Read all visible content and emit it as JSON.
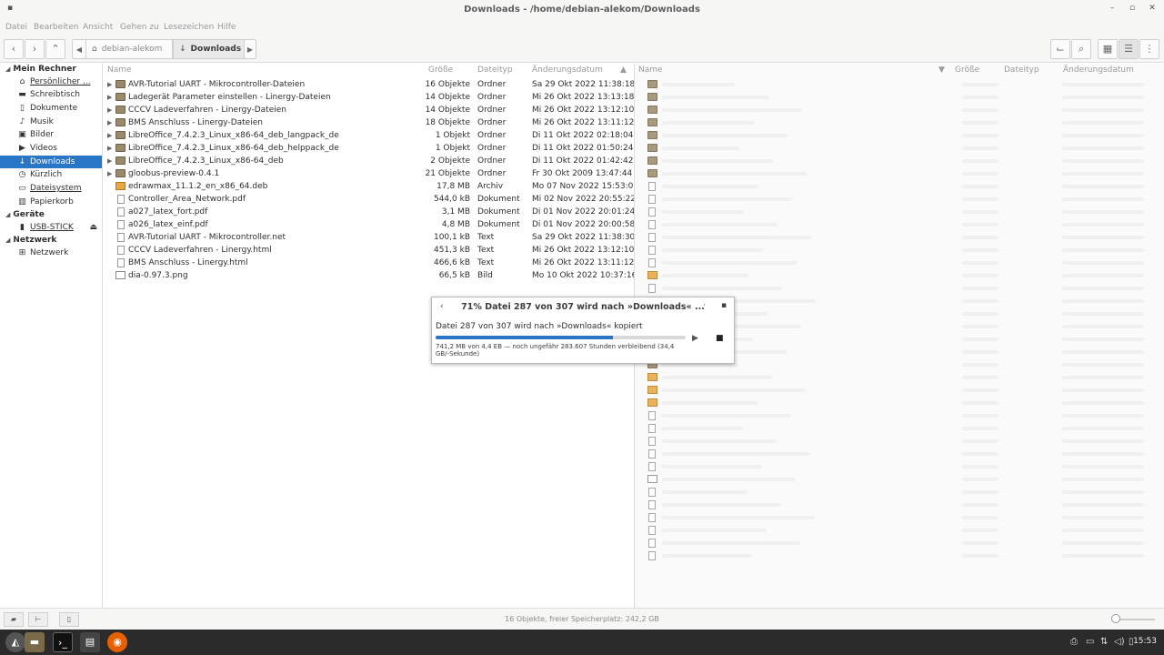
{
  "window": {
    "title": "Downloads - /home/debian-alekom/Downloads"
  },
  "menu": [
    "Datei",
    "Bearbeiten",
    "Ansicht",
    "Gehen zu",
    "Lesezeichen",
    "Hilfe"
  ],
  "path": {
    "home": "debian-alekom",
    "current": "Downloads"
  },
  "sidebar": {
    "sections": [
      {
        "title": "Mein Rechner",
        "items": [
          {
            "label": "Persönlicher ...",
            "icon": "home-icon"
          },
          {
            "label": "Schreibtisch",
            "icon": "desktop-icon"
          },
          {
            "label": "Dokumente",
            "icon": "document-icon"
          },
          {
            "label": "Musik",
            "icon": "music-icon"
          },
          {
            "label": "Bilder",
            "icon": "pictures-icon"
          },
          {
            "label": "Videos",
            "icon": "video-icon"
          },
          {
            "label": "Downloads",
            "icon": "download-icon"
          },
          {
            "label": "Kürzlich",
            "icon": "recent-icon"
          },
          {
            "label": "Dateisystem",
            "icon": "filesystem-icon"
          },
          {
            "label": "Papierkorb",
            "icon": "trash-icon"
          }
        ]
      },
      {
        "title": "Geräte",
        "items": [
          {
            "label": "USB-STICK",
            "icon": "usb-icon"
          }
        ]
      },
      {
        "title": "Netzwerk",
        "items": [
          {
            "label": "Netzwerk",
            "icon": "network-icon"
          }
        ]
      }
    ]
  },
  "columns": {
    "name": "Name",
    "size": "Größe",
    "type": "Dateityp",
    "date": "Änderungsdatum"
  },
  "files": [
    {
      "name": "AVR-Tutorial UART - Mikrocontroller-Dateien",
      "size": "16 Objekte",
      "type": "Ordner",
      "date": "Sa 29 Okt 2022 11:38:18",
      "kind": "folder"
    },
    {
      "name": "Ladegerät Parameter einstellen - Linergy-Dateien",
      "size": "14 Objekte",
      "type": "Ordner",
      "date": "Mi 26 Okt 2022 13:13:18",
      "kind": "folder"
    },
    {
      "name": "CCCV Ladeverfahren - Linergy-Dateien",
      "size": "14 Objekte",
      "type": "Ordner",
      "date": "Mi 26 Okt 2022 13:12:10",
      "kind": "folder"
    },
    {
      "name": "BMS Anschluss - Linergy-Dateien",
      "size": "18 Objekte",
      "type": "Ordner",
      "date": "Mi 26 Okt 2022 13:11:12",
      "kind": "folder"
    },
    {
      "name": "LibreOffice_7.4.2.3_Linux_x86-64_deb_langpack_de",
      "size": "1 Objekt",
      "type": "Ordner",
      "date": "Di 11 Okt 2022 02:18:04",
      "kind": "folder"
    },
    {
      "name": "LibreOffice_7.4.2.3_Linux_x86-64_deb_helppack_de",
      "size": "1 Objekt",
      "type": "Ordner",
      "date": "Di 11 Okt 2022 01:50:24",
      "kind": "folder"
    },
    {
      "name": "LibreOffice_7.4.2.3_Linux_x86-64_deb",
      "size": "2 Objekte",
      "type": "Ordner",
      "date": "Di 11 Okt 2022 01:42:42",
      "kind": "folder"
    },
    {
      "name": "gloobus-preview-0.4.1",
      "size": "21 Objekte",
      "type": "Ordner",
      "date": "Fr 30 Okt 2009 13:47:44",
      "kind": "folder"
    },
    {
      "name": "edrawmax_11.1.2_en_x86_64.deb",
      "size": "17,8 MB",
      "type": "Archiv",
      "date": "Mo 07 Nov 2022 15:53:06",
      "kind": "pkg"
    },
    {
      "name": "Controller_Area_Network.pdf",
      "size": "544,0 kB",
      "type": "Dokument",
      "date": "Mi 02 Nov 2022 20:55:22",
      "kind": "doc"
    },
    {
      "name": "a027_latex_fort.pdf",
      "size": "3,1 MB",
      "type": "Dokument",
      "date": "Di 01 Nov 2022 20:01:24",
      "kind": "doc"
    },
    {
      "name": "a026_latex_einf.pdf",
      "size": "4,8 MB",
      "type": "Dokument",
      "date": "Di 01 Nov 2022 20:00:58",
      "kind": "doc"
    },
    {
      "name": "AVR-Tutorial UART - Mikrocontroller.net",
      "size": "100,1 kB",
      "type": "Text",
      "date": "Sa 29 Okt 2022 11:38:30",
      "kind": "doc"
    },
    {
      "name": "CCCV Ladeverfahren - Linergy.html",
      "size": "451,3 kB",
      "type": "Text",
      "date": "Mi 26 Okt 2022 13:12:10",
      "kind": "doc"
    },
    {
      "name": "BMS Anschluss - Linergy.html",
      "size": "466,6 kB",
      "type": "Text",
      "date": "Mi 26 Okt 2022 13:11:12",
      "kind": "doc"
    },
    {
      "name": "dia-0.97.3.png",
      "size": "66,5 kB",
      "type": "Bild",
      "date": "Mo 10 Okt 2022 10:37:16",
      "kind": "img"
    }
  ],
  "dialog": {
    "title": "71% Datei 287 von 307 wird nach »Downloads« ...",
    "status": "Datei 287 von 307 wird nach »Downloads« kopiert",
    "progress": 0.71,
    "info": "741,2 MB von 4,4 EB — noch ungefähr 283.607 Stunden verbleibend (34,4 GB/-Sekunde)"
  },
  "statusbar": {
    "text": "16 Objekte, freier Speicherplatz: 242,2 GB"
  },
  "taskbar": {
    "clock": "15:53"
  }
}
